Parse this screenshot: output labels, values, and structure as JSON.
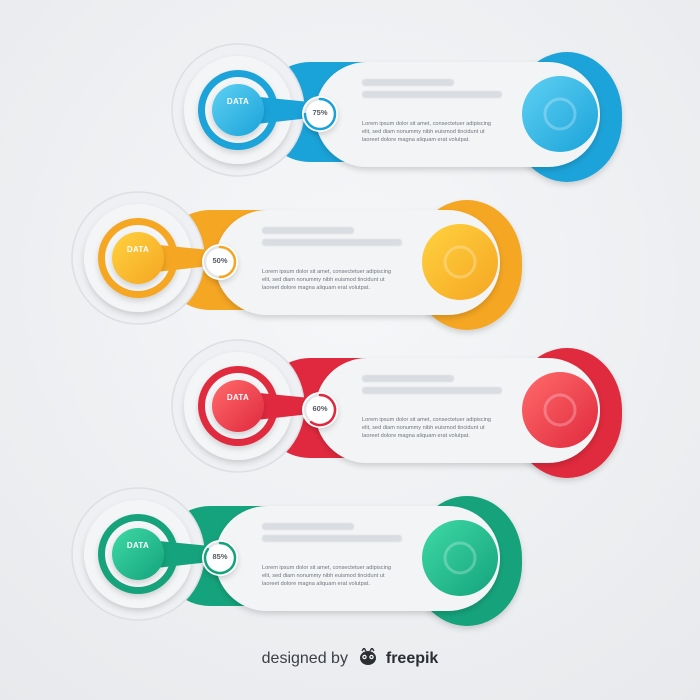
{
  "rows": [
    {
      "data_label": "DATA",
      "percent": "75%",
      "progress": 0.75,
      "color": "#1aa3d9",
      "color_light": "#5fd0f3",
      "body_line1": "Lorem ipsum dolor sit amet, consectetuer adipiscing",
      "body_line2": "elit, sed diam nonummy nibh euismod tincidunt ut",
      "body_line3": "laoreet dolore magna aliquam erat volutpat."
    },
    {
      "data_label": "DATA",
      "percent": "50%",
      "progress": 0.5,
      "color": "#f5a623",
      "color_light": "#ffd23f",
      "body_line1": "Lorem ipsum dolor sit amet, consectetuer adipiscing",
      "body_line2": "elit, sed diam nonummy nibh euismod tincidunt ut",
      "body_line3": "laoreet dolore magna aliquam erat volutpat."
    },
    {
      "data_label": "DATA",
      "percent": "60%",
      "progress": 0.6,
      "color": "#e0293e",
      "color_light": "#ff6b6b",
      "body_line1": "Lorem ipsum dolor sit amet, consectetuer adipiscing",
      "body_line2": "elit, sed diam nonummy nibh euismod tincidunt ut",
      "body_line3": "laoreet dolore magna aliquam erat volutpat."
    },
    {
      "data_label": "DATA",
      "percent": "85%",
      "progress": 0.85,
      "color": "#14a37c",
      "color_light": "#3fd9a5",
      "body_line1": "Lorem ipsum dolor sit amet, consectetuer adipiscing",
      "body_line2": "elit, sed diam nonummy nibh euismod tincidunt ut",
      "body_line3": "laoreet dolore magna aliquam erat volutpat."
    }
  ],
  "footer": {
    "designed_by": "designed by",
    "brand": "freepik",
    "logo_icon": "freepik-logo-icon"
  }
}
